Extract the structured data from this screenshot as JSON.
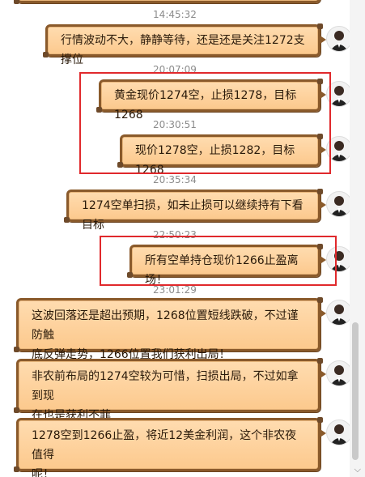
{
  "messages": [
    {
      "time": "14:45:32",
      "text": "行情波动不大，静静等待，还是还是关注1272支撑位"
    },
    {
      "time": "20:07:09",
      "text": "黄金现价1274空，止损1278，目标1268"
    },
    {
      "time": "20:30:51",
      "text": "现价1278空，止损1282，目标1268"
    },
    {
      "time": "20:35:34",
      "text": "1274空单扫损，如未止损可以继续持有下看目标"
    },
    {
      "time": "22:50:23",
      "text": "所有空单持仓现价1266止盈离场！"
    },
    {
      "time": "23:01:29",
      "text_line1": "这波回落还是超出预期，1268位置短线跌破，不过谨防触",
      "text_line2": "底反弹走势，1266位置我们获利出局！"
    },
    {
      "time": "",
      "text_line1": "非农前布局的1274空较为可惜，扫损出局，不过如拿到现",
      "text_line2": "在也是获利不菲"
    },
    {
      "time": "",
      "text_line1": "1278空到1266止盈，将近12美金利润，这个非农夜值得",
      "text_line2": "呢！"
    }
  ],
  "icons": {
    "avatar": "avatar-icon",
    "scroll_down": "chevron-down-icon"
  },
  "colors": {
    "bubble": "#fcc98d",
    "bubble_border": "#8a5a2b",
    "highlight": "#e0292c"
  }
}
